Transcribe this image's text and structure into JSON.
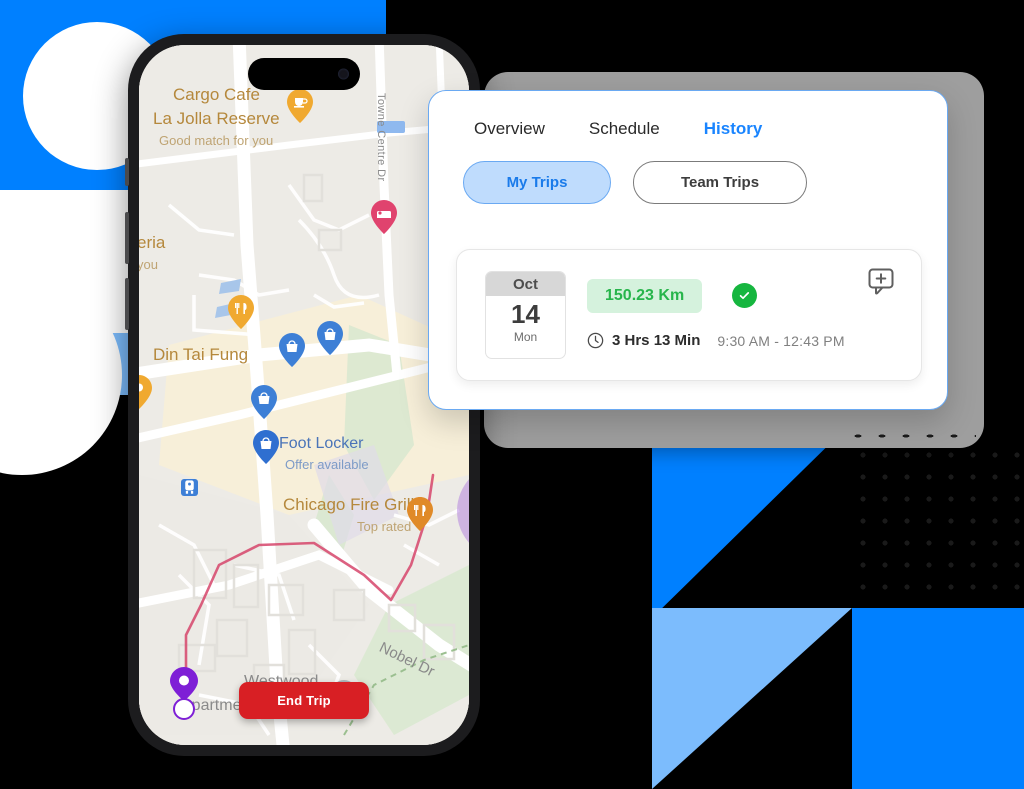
{
  "panel": {
    "tabs": [
      {
        "label": "Overview",
        "active": false
      },
      {
        "label": "Schedule",
        "active": false
      },
      {
        "label": "History",
        "active": true
      }
    ],
    "segments": [
      {
        "label": "My Trips",
        "selected": true
      },
      {
        "label": "Team Trips",
        "selected": false
      }
    ],
    "trips": [
      {
        "month": "Oct",
        "day": "14",
        "weekday": "Mon",
        "distance": "150.23 Km",
        "status": "completed",
        "duration": "3 Hrs 13 Min",
        "time_range": "9:30 AM - 12:43 PM",
        "note_icon": "add-comment-icon"
      }
    ]
  },
  "phone": {
    "map": {
      "labels": [
        {
          "text": "Cargo Cafe",
          "style": "amber"
        },
        {
          "text": "La Jolla Reserve",
          "style": "amber"
        },
        {
          "text": "Good match for you",
          "style": "sub"
        },
        {
          "text": "eria",
          "style": "amber"
        },
        {
          "text": "you",
          "style": "sub"
        },
        {
          "text": "Towne Centre Dr",
          "style": "gray"
        },
        {
          "text": "Din Tai Fung",
          "style": "amber"
        },
        {
          "text": "Foot Locker",
          "style": "blue"
        },
        {
          "text": "Offer available",
          "style": "bluesub"
        },
        {
          "text": "Chicago Fire Grill",
          "style": "amber"
        },
        {
          "text": "Top rated",
          "style": "sub"
        },
        {
          "text": "Nobel Dr",
          "style": "gray"
        },
        {
          "text": "Westwood",
          "style": "gray"
        },
        {
          "text": "Apartme",
          "style": "gray"
        }
      ],
      "pins": [
        {
          "name": "cafe-pin",
          "glyph": "cup",
          "color": "#f0a930"
        },
        {
          "name": "hotel-pin",
          "glyph": "bed",
          "color": "#e0436e"
        },
        {
          "name": "restaurant-pin",
          "glyph": "fork",
          "color": "#f0a930"
        },
        {
          "name": "shop-pin-1",
          "glyph": "bag",
          "color": "#3d7fd6"
        },
        {
          "name": "shop-pin-2",
          "glyph": "bag",
          "color": "#3d7fd6"
        },
        {
          "name": "shop-pin-3",
          "glyph": "bag",
          "color": "#3d7fd6"
        },
        {
          "name": "footlocker-pin",
          "glyph": "bag",
          "color": "#2f6fd0"
        },
        {
          "name": "grill-pin",
          "glyph": "fork",
          "color": "#e08a28"
        },
        {
          "name": "destination-pin",
          "glyph": "plain",
          "color": "#7e1fd6"
        },
        {
          "name": "transit-marker",
          "glyph": "rail",
          "color": "#3d7fd6"
        }
      ]
    },
    "end_trip_button": "End Trip"
  },
  "colors": {
    "brand_blue": "#0080ff",
    "light_blue": "#7cbcfd",
    "accent_blue": "#1a85ff",
    "success_green": "#16b63f",
    "km_green": "#27b54b",
    "danger_red": "#d81f24",
    "purple": "#7e1fd6"
  }
}
